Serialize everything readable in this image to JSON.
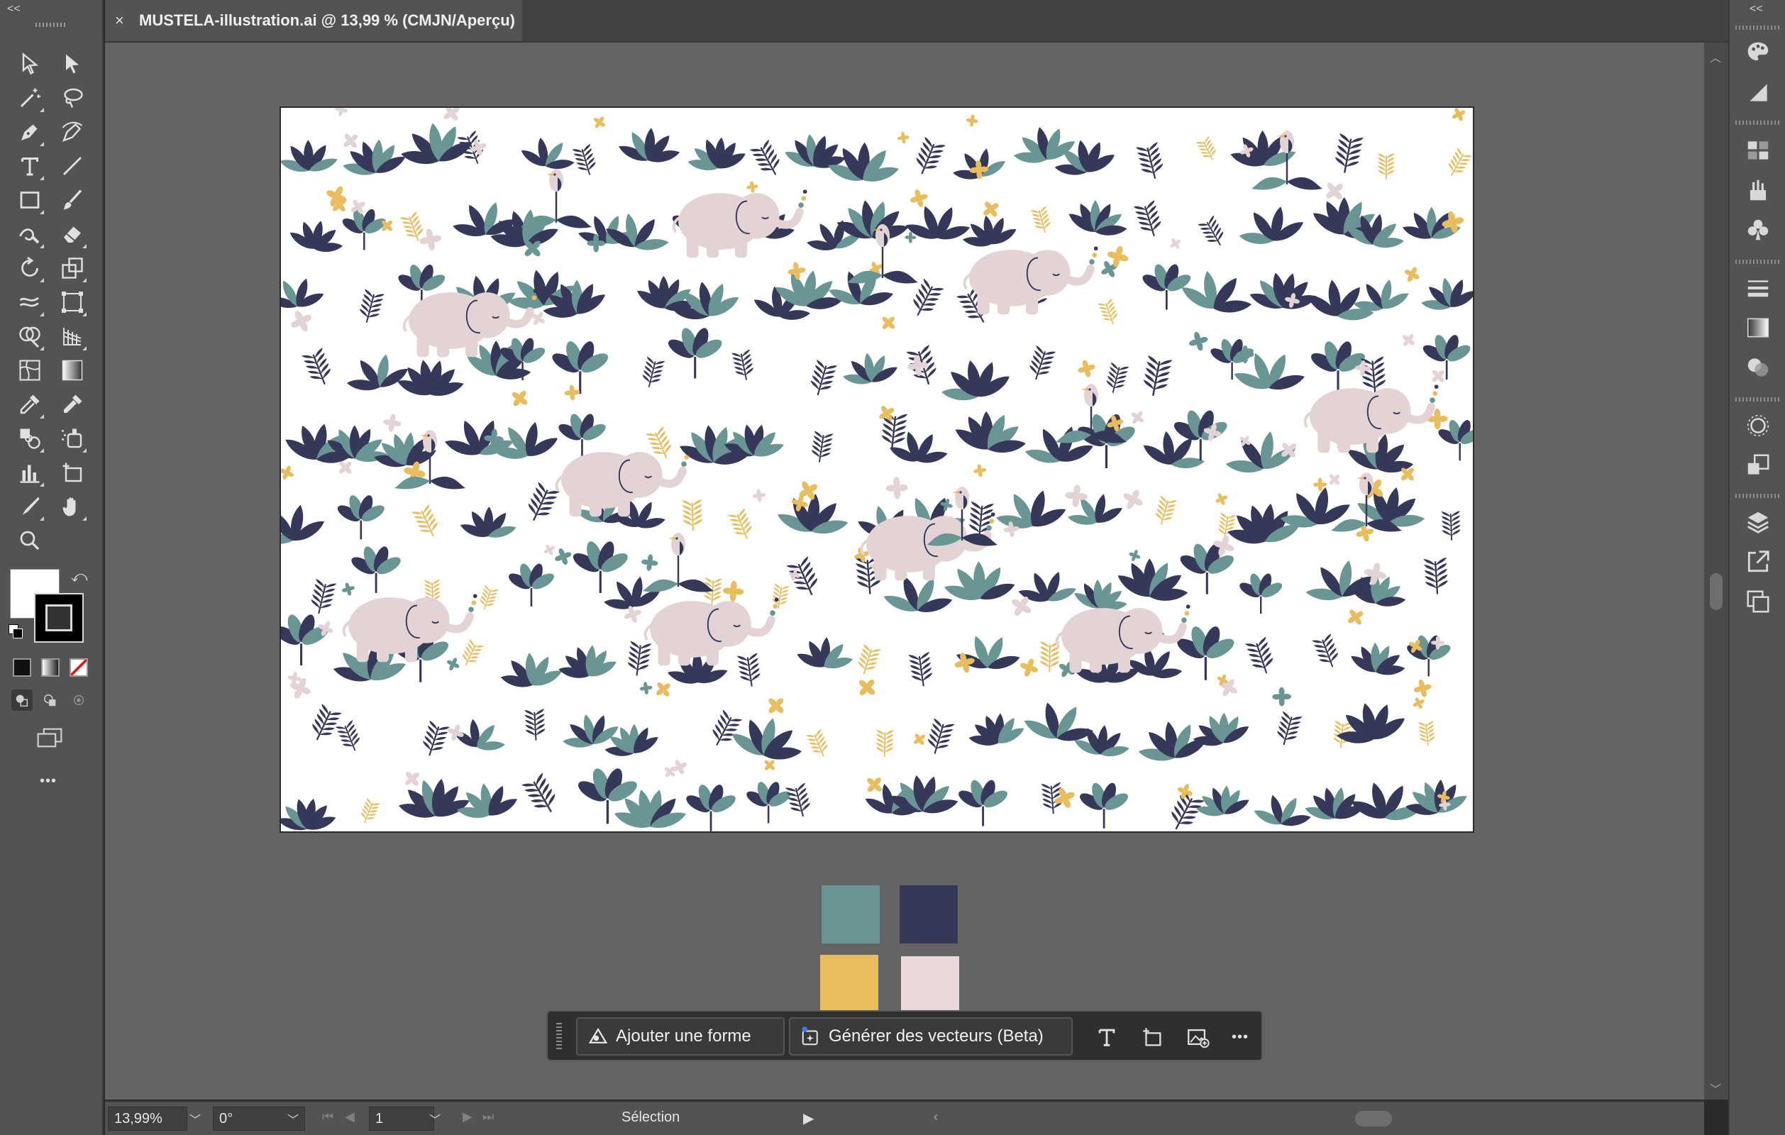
{
  "window": {
    "collapse_left": "<<",
    "collapse_right": "<<"
  },
  "document_tab": {
    "close": "×",
    "title": "MUSTELA-illustration.ai @ 13,99 % (CMJN/Aperçu)"
  },
  "palette_swatches": [
    {
      "name": "teal",
      "color": "#6a9595"
    },
    {
      "name": "navy",
      "color": "#363859"
    },
    {
      "name": "mustard",
      "color": "#e9bc5d"
    },
    {
      "name": "blush",
      "color": "#ebd8da"
    }
  ],
  "context_taskbar": {
    "add_shape_label": "Ajouter une forme",
    "generate_vectors_label": "Générer des vecteurs (Beta)",
    "more": "•••"
  },
  "left_toolbar": {
    "more": "•••"
  },
  "status_bar": {
    "zoom": "13,99%",
    "rotation": "0°",
    "artboard_number": "1",
    "current_tool": "Sélection"
  },
  "colors": {
    "ui_bg": "#535353",
    "canvas_bg": "#646464",
    "leaf_dark": "#363859",
    "leaf_teal": "#6a9595",
    "flower_yellow": "#e9bc5d",
    "elephant_pink": "#e4d3d5"
  }
}
